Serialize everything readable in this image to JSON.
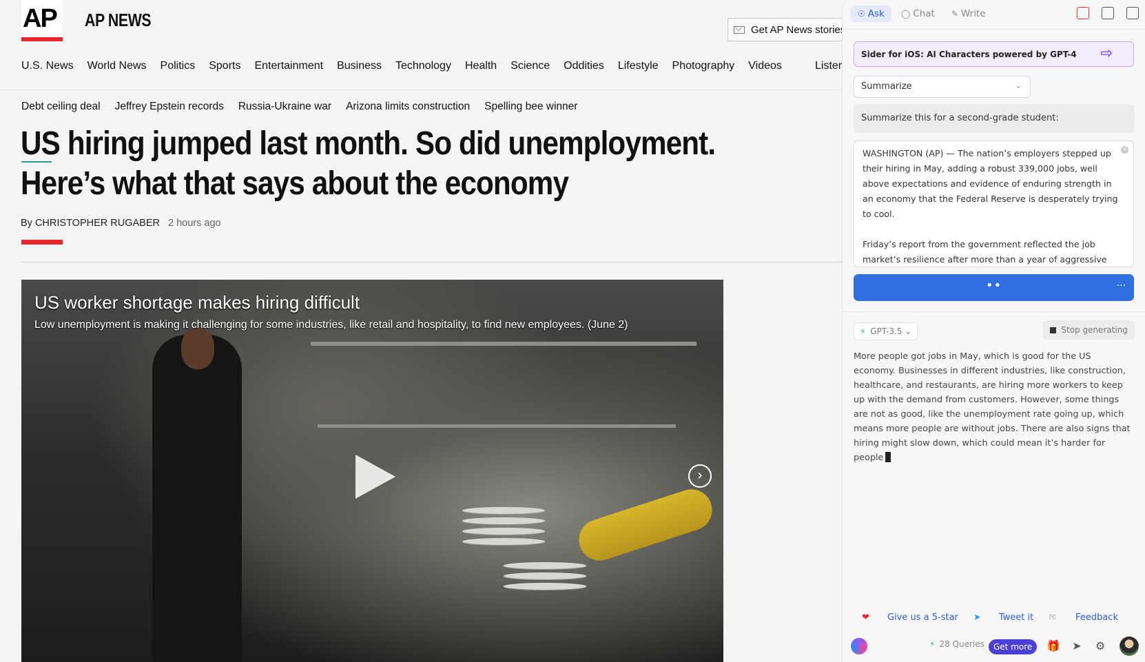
{
  "ap": {
    "logo": "AP",
    "brand": "AP NEWS",
    "get_stories": "Get AP News stories",
    "nav": [
      "U.S. News",
      "World News",
      "Politics",
      "Sports",
      "Entertainment",
      "Business",
      "Technology",
      "Health",
      "Science",
      "Oddities",
      "Lifestyle",
      "Photography",
      "Videos"
    ],
    "listen": "Listen",
    "trending": [
      "Debt ceiling deal",
      "Jeffrey Epstein records",
      "Russia-Ukraine war",
      "Arizona limits construction",
      "Spelling bee winner"
    ],
    "headline": "US hiring jumped last month. So did unemployment. Here’s what that says about the economy",
    "byline_prefix": "By",
    "author": "CHRISTOPHER RUGABER",
    "time": "2 hours ago",
    "video": {
      "title": "US worker shortage makes hiring difficult",
      "subtitle": "Low unemployment is making it challenging for some industries, like retail and hospitality, to find new employees. (June 2)",
      "next": "›"
    },
    "accent": "#e8272a"
  },
  "sider": {
    "tabs": [
      {
        "label": "Ask",
        "icon": "person-icon",
        "active": true
      },
      {
        "label": "Chat",
        "icon": "chat-bubble-icon",
        "active": false
      },
      {
        "label": "Write",
        "icon": "pen-icon",
        "active": false
      }
    ],
    "promo": "Sider for iOS: AI Characters powered by GPT-4",
    "promo_arrow": "⇨",
    "action_select": "Summarize",
    "prompt_label": "Summarize this for a second-grade student:",
    "source_text": [
      "WASHINGTON (AP) — The nation’s employers stepped up their hiring in May, adding a robust 339,000 jobs, well above expectations and evidence of enduring strength in an economy that the Federal Reserve is desperately trying to cool.",
      "Friday’s report from the government reflected the job market’s resilience after more than a year of aggressive"
    ],
    "go_dots": "••",
    "go_more": "···",
    "model": "GPT-3.5",
    "stop": "Stop generating",
    "answer": "More people got jobs in May, which is good for the US economy. Businesses in different industries, like construction, healthcare, and restaurants, are hiring more workers to keep up with the demand from customers. However, some things are not as good, like the unemployment rate going up, which means more people are without jobs. There are also signs that hiring might slow down, which could mean it’s harder for people",
    "footer": {
      "rate": "Give us a 5-star",
      "tweet": "Tweet it",
      "feedback": "Feedback"
    },
    "queries": "28 Queries",
    "get_more": "Get more",
    "accent": "#2f6fe0"
  }
}
